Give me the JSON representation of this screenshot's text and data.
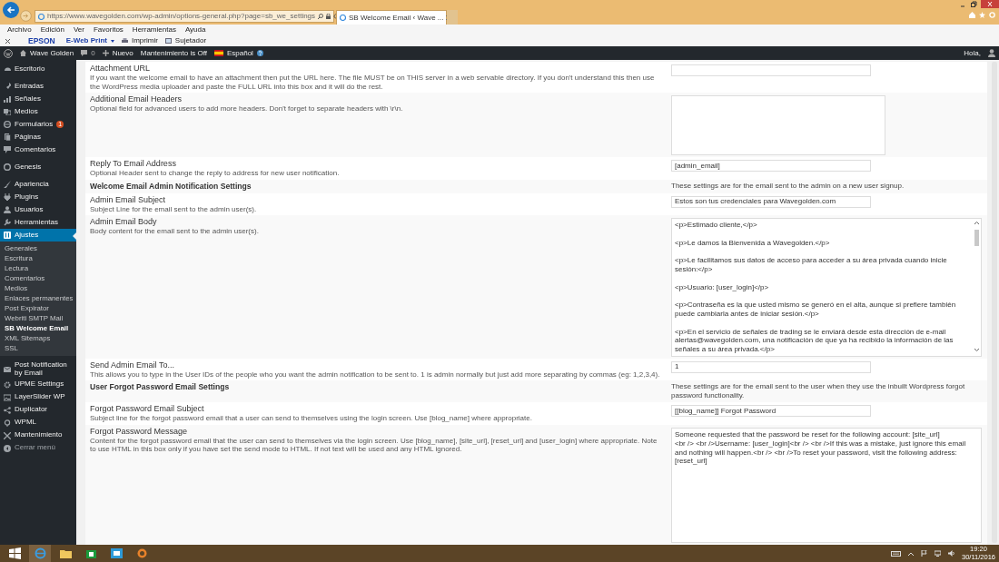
{
  "browser": {
    "url": "https://www.wavegolden.com/wp-admin/options-general.php?page=sb_we_settings",
    "tab": "SB Welcome Email ‹ Wave ...",
    "menu": [
      "Archivo",
      "Edición",
      "Ver",
      "Favoritos",
      "Herramientas",
      "Ayuda"
    ],
    "toolbar": [
      "EPSON",
      "E-Web Print",
      "Imprimir",
      "Sujetador"
    ]
  },
  "admin_bar": {
    "site": "Wave Golden",
    "comments": "0",
    "new": "Nuevo",
    "maintenance": "Mantenimiento is Off",
    "language": "Español",
    "greeting": "Hola,"
  },
  "sidebar": {
    "items": [
      {
        "label": "Escritorio",
        "selected": false,
        "separator": true
      },
      {
        "label": "Entradas",
        "selected": false
      },
      {
        "label": "Señales",
        "selected": false
      },
      {
        "label": "Medios",
        "selected": false
      },
      {
        "label": "Formularios",
        "selected": false,
        "badge": "1"
      },
      {
        "label": "Páginas",
        "selected": false
      },
      {
        "label": "Comentarios",
        "selected": false,
        "separator": true
      },
      {
        "label": "Genesis",
        "selected": false,
        "separator": true
      },
      {
        "label": "Apariencia",
        "selected": false
      },
      {
        "label": "Plugins",
        "selected": false
      },
      {
        "label": "Usuarios",
        "selected": false
      },
      {
        "label": "Herramientas",
        "selected": false
      },
      {
        "label": "Ajustes",
        "selected": true,
        "separator": true,
        "children": [
          {
            "label": "Generales",
            "selected": false
          },
          {
            "label": "Escritura",
            "selected": false
          },
          {
            "label": "Lectura",
            "selected": false
          },
          {
            "label": "Comentarios",
            "selected": false
          },
          {
            "label": "Medios",
            "selected": false
          },
          {
            "label": "Enlaces permanentes",
            "selected": false
          },
          {
            "label": "Post Expirator",
            "selected": false
          },
          {
            "label": "Webriti SMTP Mail",
            "selected": false
          },
          {
            "label": "SB Welcome Email",
            "selected": true
          },
          {
            "label": "XML Sitemaps",
            "selected": false
          },
          {
            "label": "SSL",
            "selected": false
          }
        ]
      },
      {
        "label": "Post Notification by Email",
        "selected": false
      },
      {
        "label": "UPME Settings",
        "selected": false
      },
      {
        "label": "LayerSlider WP",
        "selected": false
      },
      {
        "label": "Duplicator",
        "selected": false
      },
      {
        "label": "WPML",
        "selected": false
      },
      {
        "label": "Mantenimiento",
        "selected": false
      }
    ],
    "collapse": "Cerrar menú"
  },
  "settings": [
    {
      "kind": "field",
      "label": "Attachment URL",
      "description": "If you want the welcome email to have an attachment then put the URL here. The file MUST be on THIS server in a web servable directory. If you don't understand this then use the WordPress media uploader and paste the FULL URL into this box and it will do the rest.",
      "control": {
        "kind": "input"
      }
    },
    {
      "kind": "field",
      "label": "Additional Email Headers",
      "description": "Optional field for advanced users to add more headers. Don't forget to separate headers with \\r\\n.",
      "control": {
        "kind": "textarea"
      }
    },
    {
      "kind": "field",
      "label": "Reply To Email Address",
      "description": "Optional Header sent to change the reply to address for new user notification.",
      "control": {
        "kind": "input",
        "value": "[admin_email]"
      }
    },
    {
      "kind": "section",
      "label": "Welcome Email Admin Notification Settings",
      "description": "These settings are for the email sent to the admin on a new user signup."
    },
    {
      "kind": "field",
      "label": "Admin Email Subject",
      "description": "Subject Line for the email sent to the admin user(s).",
      "control": {
        "kind": "input",
        "value": "Estos son tus credenciales para Wavegolden.com"
      }
    },
    {
      "kind": "field",
      "label": "Admin Email Body",
      "description": "Body content for the email sent to the admin user(s).",
      "control": {
        "kind": "scroll_textarea",
        "value": "<p>Estimado cliente,</p>\n\n<p>Le damos la Bienvenida a Wavegolden.</p>\n\n<p>Le facilitamos sus datos de acceso para acceder a su área privada cuando inicie sesión:</p>\n\n<p>Usuario: [user_login]</p>\n\n<p>Contraseña es la que usted mismo se generó en el alta, aunque si prefiere también puede cambiarla antes de iniciar sesión.</p>\n\n<p>En el servicio de señales de trading se le enviará desde esta dirección de e-mail alertas@wavegolden.com, una notificación de que ya ha recibido la información de las señales a su área privada.</p>"
      }
    },
    {
      "kind": "field",
      "label": "Send Admin Email To...",
      "description": "This allows you to type in the User IDs of the people who you want the admin notification to be sent to. 1 is admin normally but just add more separating by commas (eg: 1,2,3,4).",
      "control": {
        "kind": "input",
        "value": "1"
      }
    },
    {
      "kind": "section",
      "label": "User Forgot Password Email Settings",
      "description": "These settings are for the email sent to the user when they use the inbuilt Wordpress forgot password functionality."
    },
    {
      "kind": "field",
      "label": "Forgot Password Email Subject",
      "description": "Subject line for the forgot password email that a user can send to themselves using the login screen. Use [blog_name] where appropriate.",
      "control": {
        "kind": "input",
        "value": "[[blog_name]] Forgot Password"
      }
    },
    {
      "kind": "field",
      "label": "Forgot Password Message",
      "description": "Content for the forgot password email that the user can send to themselves via the login screen. Use [blog_name], [site_url], [reset_url] and [user_login] where appropriate. Note to use HTML in this box only if you have set the send mode to HTML. If not text will be used and any HTML ignored.",
      "control": {
        "kind": "textarea",
        "value": "Someone requested that the password be reset for the following account: [site_url]\n<br /> <br />Username: [user_login]<br /> <br />If this was a mistake, just ignore this email and nothing will happen.<br /> <br />To reset your password, visit the following address: [reset_url]"
      }
    }
  ],
  "taskbar": {
    "time": "19:20",
    "date": "30/11/2016"
  }
}
